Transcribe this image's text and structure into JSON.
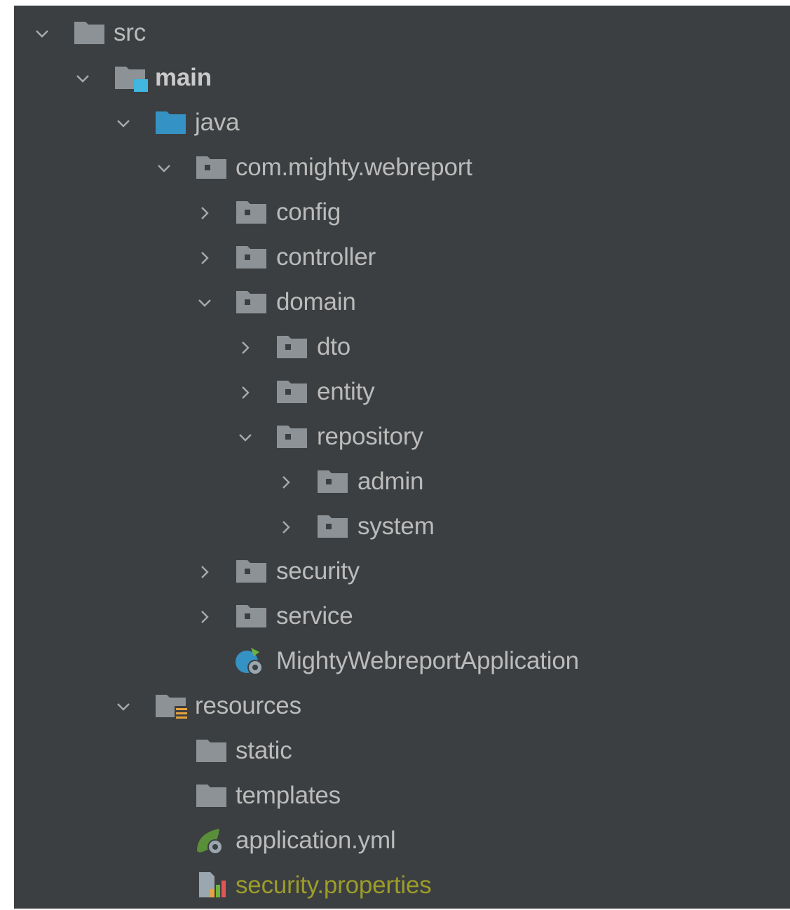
{
  "tree": {
    "src": "src",
    "main": "main",
    "java": "java",
    "package": "com.mighty.webreport",
    "config": "config",
    "controller": "controller",
    "domain": "domain",
    "dto": "dto",
    "entity": "entity",
    "repository": "repository",
    "admin": "admin",
    "system": "system",
    "security": "security",
    "service": "service",
    "app_class": "MightyWebreportApplication",
    "resources": "resources",
    "static": "static",
    "templates": "templates",
    "application_yml": "application.yml",
    "security_properties": "security.properties"
  },
  "colors": {
    "background": "#3c3f41",
    "text": "#bbbbbb",
    "folder": "#8c9296",
    "source_folder": "#3592c4",
    "unversioned_file": "#9c9c2a"
  }
}
